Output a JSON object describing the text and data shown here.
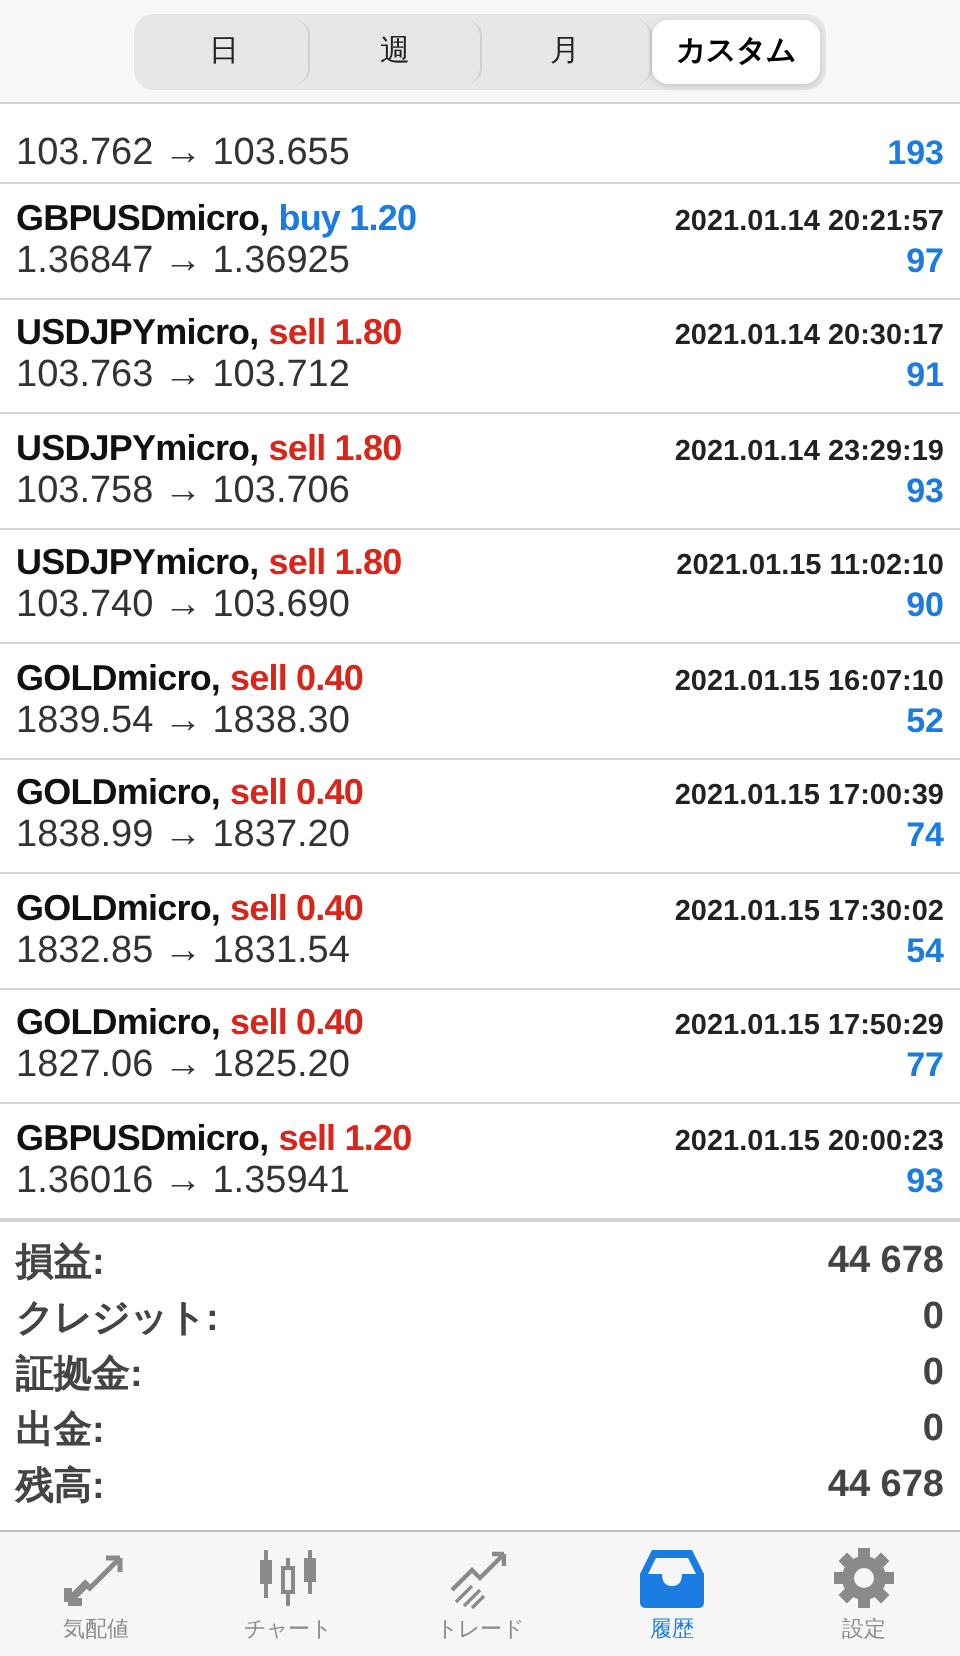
{
  "segments": [
    {
      "label": "日",
      "selected": false
    },
    {
      "label": "週",
      "selected": false
    },
    {
      "label": "月",
      "selected": false
    },
    {
      "label": "カスタム",
      "selected": true
    }
  ],
  "trades": [
    {
      "prices": "103.762 → 103.655",
      "profit": "193"
    },
    {
      "symbol": "GBPUSDmicro,",
      "side": "buy",
      "volume": "1.20",
      "time": "2021.01.14 20:21:57",
      "prices": "1.36847 → 1.36925",
      "profit": "97"
    },
    {
      "symbol": "USDJPYmicro,",
      "side": "sell",
      "volume": "1.80",
      "time": "2021.01.14 20:30:17",
      "prices": "103.763 → 103.712",
      "profit": "91"
    },
    {
      "symbol": "USDJPYmicro,",
      "side": "sell",
      "volume": "1.80",
      "time": "2021.01.14 23:29:19",
      "prices": "103.758 → 103.706",
      "profit": "93"
    },
    {
      "symbol": "USDJPYmicro,",
      "side": "sell",
      "volume": "1.80",
      "time": "2021.01.15 11:02:10",
      "prices": "103.740 → 103.690",
      "profit": "90"
    },
    {
      "symbol": "GOLDmicro,",
      "side": "sell",
      "volume": "0.40",
      "time": "2021.01.15 16:07:10",
      "prices": "1839.54 → 1838.30",
      "profit": "52"
    },
    {
      "symbol": "GOLDmicro,",
      "side": "sell",
      "volume": "0.40",
      "time": "2021.01.15 17:00:39",
      "prices": "1838.99 → 1837.20",
      "profit": "74"
    },
    {
      "symbol": "GOLDmicro,",
      "side": "sell",
      "volume": "0.40",
      "time": "2021.01.15 17:30:02",
      "prices": "1832.85 → 1831.54",
      "profit": "54"
    },
    {
      "symbol": "GOLDmicro,",
      "side": "sell",
      "volume": "0.40",
      "time": "2021.01.15 17:50:29",
      "prices": "1827.06 → 1825.20",
      "profit": "77"
    },
    {
      "symbol": "GBPUSDmicro,",
      "side": "sell",
      "volume": "1.20",
      "time": "2021.01.15 20:00:23",
      "prices": "1.36016 → 1.35941",
      "profit": "93"
    }
  ],
  "summary": [
    {
      "label": "損益:",
      "value": "44 678"
    },
    {
      "label": "クレジット:",
      "value": "0"
    },
    {
      "label": "証拠金:",
      "value": "0"
    },
    {
      "label": "出金:",
      "value": "0"
    },
    {
      "label": "残高:",
      "value": "44 678"
    }
  ],
  "tab_bar": [
    {
      "kind": "quotes",
      "label": "気配値",
      "selected": false
    },
    {
      "kind": "chart",
      "label": "チャート",
      "selected": false
    },
    {
      "kind": "trade",
      "label": "トレード",
      "selected": false
    },
    {
      "kind": "history",
      "label": "履歴",
      "selected": true
    },
    {
      "kind": "settings",
      "label": "設定",
      "selected": false
    }
  ]
}
